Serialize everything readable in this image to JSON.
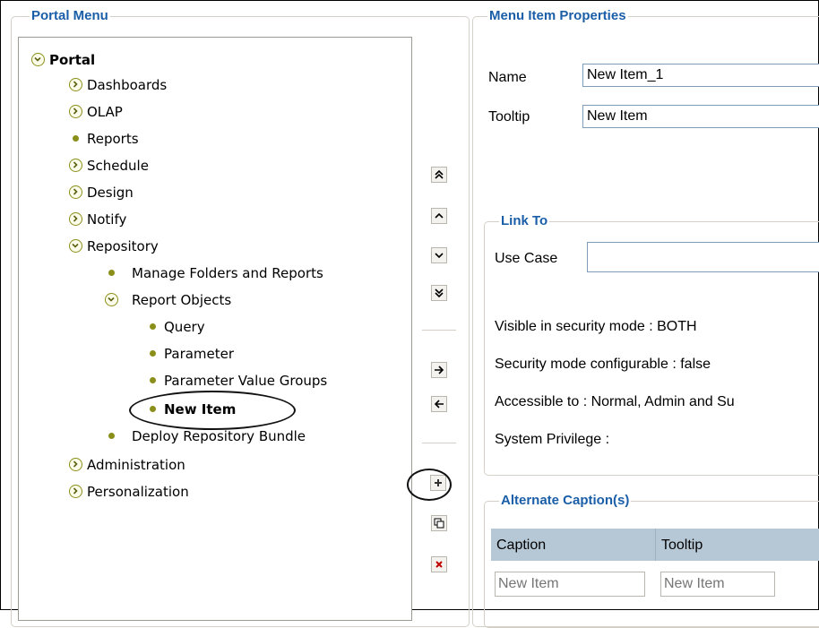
{
  "portal_menu": {
    "legend": "Portal Menu",
    "tree": [
      {
        "label": "Portal",
        "kind": "expanded",
        "bold": true
      },
      {
        "label": "Dashboards",
        "kind": "collapsed"
      },
      {
        "label": "OLAP",
        "kind": "collapsed"
      },
      {
        "label": "Reports",
        "kind": "leaf"
      },
      {
        "label": "Schedule",
        "kind": "collapsed"
      },
      {
        "label": "Design",
        "kind": "collapsed"
      },
      {
        "label": "Notify",
        "kind": "collapsed"
      },
      {
        "label": "Repository",
        "kind": "expanded"
      },
      {
        "label": "Manage Folders and Reports",
        "kind": "leaf"
      },
      {
        "label": "Report Objects",
        "kind": "expanded"
      },
      {
        "label": "Query",
        "kind": "leaf"
      },
      {
        "label": "Parameter",
        "kind": "leaf"
      },
      {
        "label": "Parameter Value Groups",
        "kind": "leaf"
      },
      {
        "label": "New Item",
        "kind": "leaf",
        "bold": true
      },
      {
        "label": "Deploy Repository Bundle",
        "kind": "leaf"
      },
      {
        "label": "Administration",
        "kind": "collapsed"
      },
      {
        "label": "Personalization",
        "kind": "collapsed"
      }
    ]
  },
  "toolbar": {
    "move_top": "≫",
    "move_up": "^",
    "move_down": "v",
    "move_bottom": "≫",
    "indent": "→",
    "outdent": "←",
    "add": "+",
    "copy": "⧉",
    "delete": "×"
  },
  "properties": {
    "legend": "Menu Item Properties",
    "name_label": "Name",
    "name_value": "New Item_1",
    "tooltip_label": "Tooltip",
    "tooltip_value": "New Item",
    "link_to": {
      "legend": "Link To",
      "use_case_label": "Use Case",
      "use_case_value": "",
      "visible_mode": "Visible in security mode : BOTH",
      "security_configurable": "Security mode configurable : false",
      "accessible_to": "Accessible to : Normal, Admin and Su",
      "system_privilege": "System Privilege :"
    },
    "alternate": {
      "legend": "Alternate Caption(s)",
      "col_caption": "Caption",
      "col_tooltip": "Tooltip",
      "caption_placeholder": "New Item",
      "tooltip_placeholder": "New Item"
    }
  },
  "colors": {
    "legend": "#1a5ea8",
    "tree_icon": "#8a8f1a",
    "table_header": "#b6c7d6"
  }
}
